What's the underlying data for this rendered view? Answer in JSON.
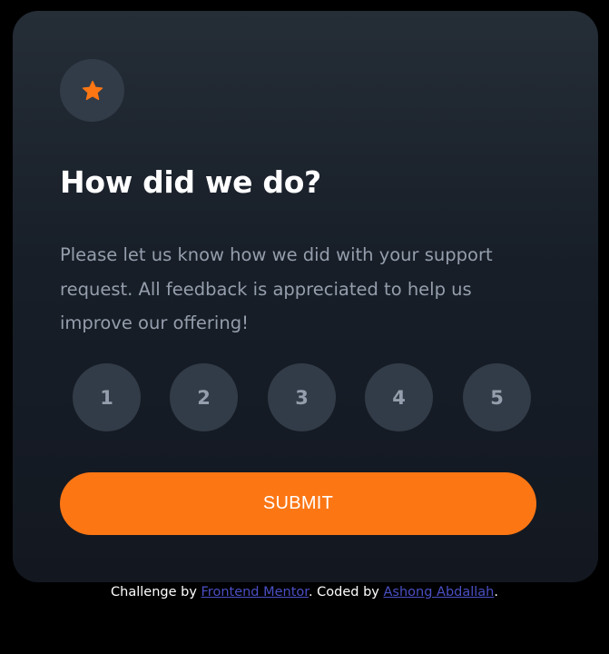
{
  "card": {
    "icon": "star-icon",
    "title": "How did we do?",
    "description": "Please let us know how we did with your support request. All feedback is appreciated to help us improve our offering!",
    "ratings": [
      "1",
      "2",
      "3",
      "4",
      "5"
    ],
    "submit_label": "SUBMIT"
  },
  "attribution": {
    "prefix": "Challenge by ",
    "link1": "Frontend Mentor",
    "middle": ". Coded by ",
    "link2": "Ashong Abdallah",
    "suffix": "."
  },
  "colors": {
    "accent": "#fc7614",
    "background": "#000000",
    "card_top": "#252d37",
    "card_bottom": "#131820",
    "circle": "#323c48",
    "muted_text": "#959eac",
    "link": "#4a4fc4"
  }
}
